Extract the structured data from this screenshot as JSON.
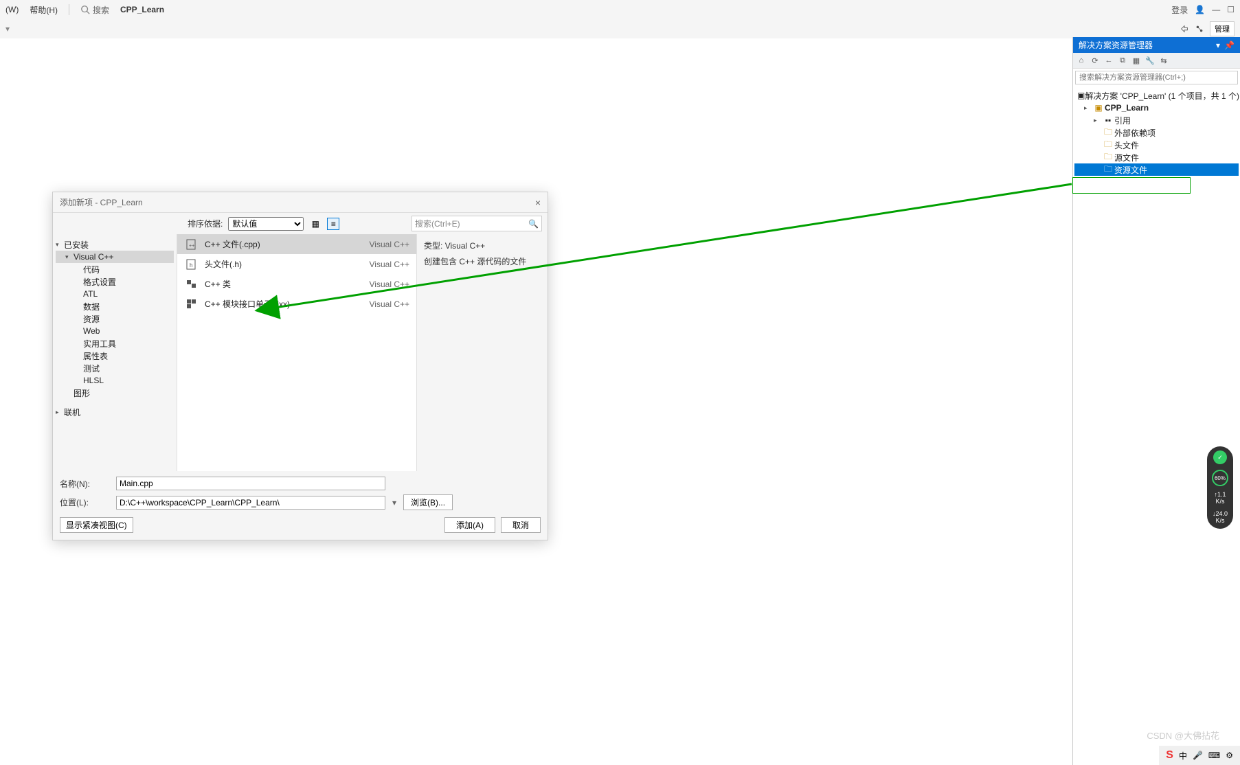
{
  "menubar": {
    "window": "(W)",
    "help": "帮助(H)",
    "search_label": "搜索",
    "project": "CPP_Learn",
    "login": "登录",
    "manage": "管理"
  },
  "solution": {
    "title": "解决方案资源管理器",
    "search_placeholder": "搜索解决方案资源管理器(Ctrl+;)",
    "root": "解决方案 'CPP_Learn' (1 个项目，共 1 个)",
    "project": "CPP_Learn",
    "nodes": {
      "refs": "引用",
      "external": "外部依赖项",
      "headers": "头文件",
      "sources": "源文件",
      "resources": "资源文件"
    }
  },
  "dialog": {
    "title": "添加新项 - CPP_Learn",
    "sort_label": "排序依据:",
    "sort_value": "默认值",
    "search_placeholder": "搜索(Ctrl+E)",
    "categories": {
      "installed": "已安装",
      "visualcpp": "Visual C++",
      "code": "代码",
      "format": "格式设置",
      "atl": "ATL",
      "data": "数据",
      "resource": "资源",
      "web": "Web",
      "util": "实用工具",
      "propsheet": "属性表",
      "test": "测试",
      "hlsl": "HLSL",
      "graphics": "图形",
      "online": "联机"
    },
    "templates": [
      {
        "name": "C++ 文件(.cpp)",
        "lang": "Visual C++"
      },
      {
        "name": "头文件(.h)",
        "lang": "Visual C++"
      },
      {
        "name": "C++ 类",
        "lang": "Visual C++"
      },
      {
        "name": "C++ 模块接口单元(.ixx)",
        "lang": "Visual C++"
      }
    ],
    "desc": {
      "type_label": "类型:",
      "type_value": "Visual C++",
      "summary": "创建包含 C++ 源代码的文件"
    },
    "name_label": "名称(N):",
    "name_value": "Main.cpp",
    "loc_label": "位置(L):",
    "loc_value": "D:\\C++\\workspace\\CPP_Learn\\CPP_Learn\\",
    "browse": "浏览(B)...",
    "compact": "显示紧凑视图(C)",
    "add": "添加(A)",
    "cancel": "取消"
  },
  "sys": {
    "pct": "60%",
    "up": "1.1",
    "up_unit": "K/s",
    "down": "24.0",
    "down_unit": "K/s"
  },
  "watermark": "CSDN @大佛拈花"
}
